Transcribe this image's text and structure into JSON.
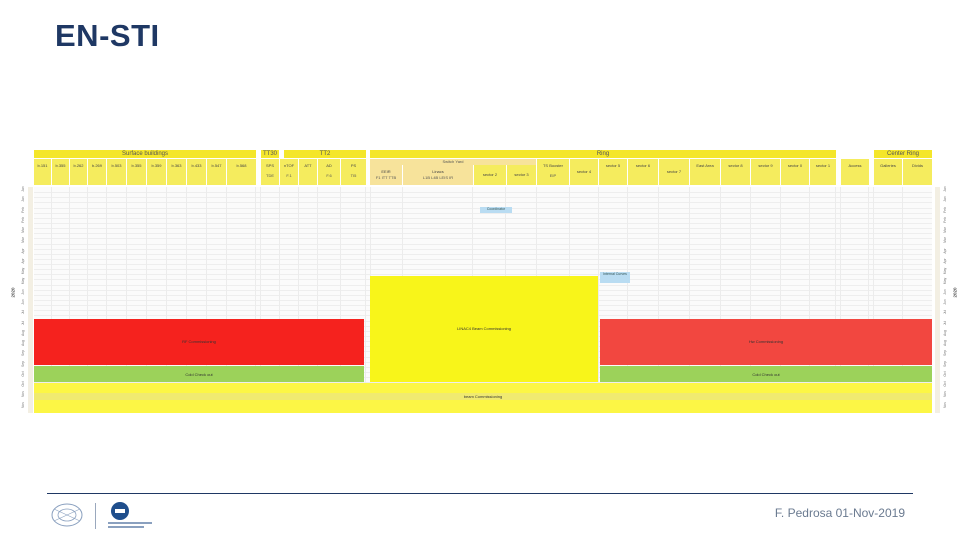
{
  "slide": {
    "title": "EN-STI",
    "footer": "F. Pedrosa 01-Nov-2019"
  },
  "header": {
    "groups": [
      {
        "label": "Surface buildings"
      },
      {
        "label": "TT30"
      },
      {
        "label": "TT2"
      },
      {
        "label": "Ring"
      },
      {
        "label": "Center Ring"
      }
    ],
    "columns": [
      {
        "label": "b.151",
        "sub": ""
      },
      {
        "label": "b.355",
        "sub": ""
      },
      {
        "label": "b.262",
        "sub": ""
      },
      {
        "label": "b.269",
        "sub": ""
      },
      {
        "label": "b.503",
        "sub": ""
      },
      {
        "label": "b.355",
        "sub": ""
      },
      {
        "label": "b.359",
        "sub": ""
      },
      {
        "label": "b.363",
        "sub": ""
      },
      {
        "label": "b.433",
        "sub": ""
      },
      {
        "label": "b.547",
        "sub": ""
      },
      {
        "label": "b.568",
        "sub": ""
      },
      {
        "label": "SPS",
        "sub": "TDE"
      },
      {
        "label": "nTOF",
        "sub": "F.1"
      },
      {
        "label": "ATT",
        "sub": ""
      },
      {
        "label": "AD",
        "sub": "F.6"
      },
      {
        "label": "PS",
        "sub": "TI5"
      },
      {
        "label": "EEIR",
        "sub": ""
      },
      {
        "label": "Linacs",
        "sub": ""
      },
      {
        "label": "sector 2",
        "sub": ""
      },
      {
        "label": "sector 3",
        "sub": ""
      },
      {
        "label": "TS Booster",
        "sub": "EIP"
      },
      {
        "label": "sector 4",
        "sub": ""
      },
      {
        "label": "sector 5",
        "sub": ""
      },
      {
        "label": "sector 6",
        "sub": ""
      },
      {
        "label": "sector 7",
        "sub": ""
      },
      {
        "label": "East Area",
        "sub": ""
      },
      {
        "label": "sector 8",
        "sub": ""
      },
      {
        "label": "sector 9",
        "sub": ""
      },
      {
        "label": "sector 0",
        "sub": ""
      },
      {
        "label": "sector 1",
        "sub": ""
      },
      {
        "label": "Access",
        "sub": ""
      },
      {
        "label": "Galleries",
        "sub": ""
      },
      {
        "label": "Divids",
        "sub": ""
      }
    ],
    "switch_yard": "Switch Yard",
    "eeir_sub": "F1  ITT  TTB",
    "linacs_sub": "L1B    L4B  LEIS  IR"
  },
  "timeline": {
    "year": "2020",
    "left_months": [
      "Jan",
      "Jan",
      "Feb",
      "Feb",
      "Mar",
      "Mar",
      "Apr",
      "Apr",
      "May",
      "May",
      "Jun",
      "Jun",
      "Jul",
      "Jul",
      "Aug",
      "Aug",
      "Sep",
      "Sep",
      "Oct",
      "Oct",
      "Nov",
      "Nov"
    ],
    "right_months": [
      "Jan",
      "Jan",
      "Feb",
      "Feb",
      "Mar",
      "Mar",
      "Apr",
      "Apr",
      "May",
      "May",
      "Jun",
      "Jun",
      "Jul",
      "Jul",
      "Aug",
      "Aug",
      "Sep",
      "Sep",
      "Oct",
      "Oct",
      "Nov",
      "Nov"
    ]
  },
  "blocks": {
    "rf_commissioning": "RF Commissioning",
    "cold_checkout_left": "Cold Check out",
    "linac4_beam_commissioning": "LINAC4 Beam Commissioning",
    "hw_commissioning": "Hw Commissioning",
    "cold_checkout_right": "Cold Check out",
    "beam_commissioning": "beam Commissioning",
    "note_top": "Coordinator",
    "note_mid": "Internal Curves"
  },
  "colors": {
    "title": "#1f3864",
    "header_yellow": "#f4e62a",
    "red": "#f5221e",
    "green": "#9cd25a",
    "yellow": "#f8f51a",
    "note_blue": "#b9dcf2"
  }
}
